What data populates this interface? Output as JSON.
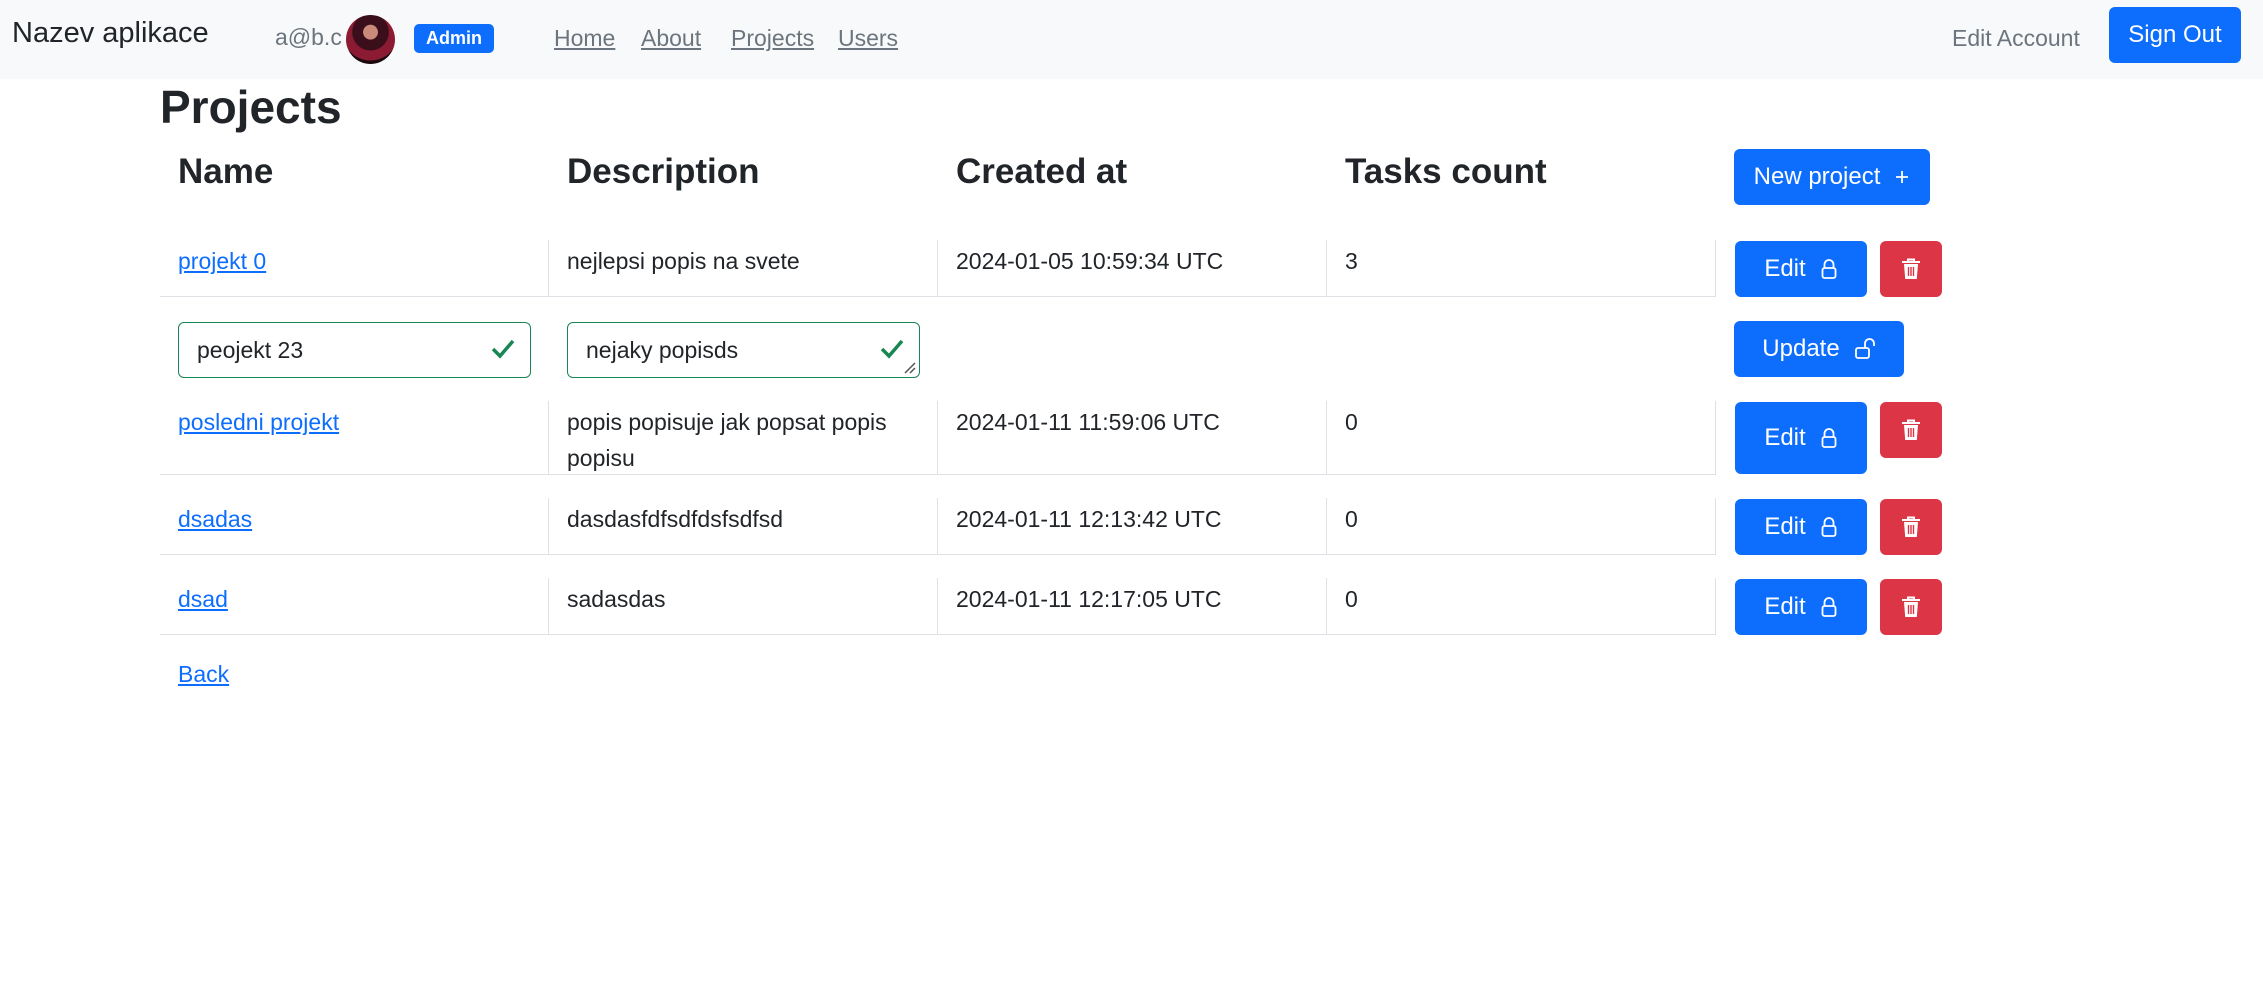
{
  "app": {
    "brand": "Nazev aplikace",
    "user_email": "a@b.c",
    "role_badge": "Admin"
  },
  "nav": {
    "home": "Home",
    "about": "About",
    "projects": "Projects",
    "users": "Users",
    "edit_account": "Edit Account",
    "sign_out": "Sign Out"
  },
  "page": {
    "title": "Projects",
    "new_project_label": "New project",
    "back_label": "Back"
  },
  "table": {
    "headers": {
      "name": "Name",
      "description": "Description",
      "created_at": "Created at",
      "tasks_count": "Tasks count"
    },
    "rows": [
      {
        "name": "projekt 0",
        "description": "nejlepsi popis na svete",
        "created_at": "2024-01-05 10:59:34 UTC",
        "tasks": "3"
      },
      {
        "name": "posledni projekt",
        "description": "popis popisuje jak popsat popis popisu",
        "created_at": "2024-01-11 11:59:06 UTC",
        "tasks": "0"
      },
      {
        "name": "dsadas",
        "description": "dasdasfdfsdfdsfsdfsd",
        "created_at": "2024-01-11 12:13:42 UTC",
        "tasks": "0"
      },
      {
        "name": "dsad",
        "description": "sadasdas",
        "created_at": "2024-01-11 12:17:05 UTC",
        "tasks": "0"
      }
    ],
    "edit_row": {
      "name_value": "peojekt 23",
      "description_value": "nejaky popisds",
      "update_label": "Update"
    },
    "edit_label": "Edit"
  },
  "colors": {
    "primary": "#0d6efd",
    "danger": "#dc3545",
    "valid": "#198754"
  },
  "icons": {
    "lock": "lock-icon",
    "unlock": "unlock-icon",
    "trash": "trash-icon",
    "plus": "plus-icon",
    "check": "check-icon"
  }
}
